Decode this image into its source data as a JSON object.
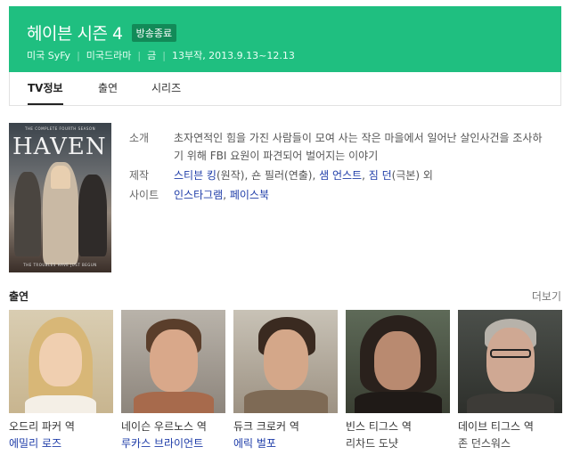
{
  "header": {
    "title": "헤이븐 시즌 4",
    "badge": "방송종료",
    "country": "미국 SyFy",
    "genre": "미국드라마",
    "day": "금",
    "episodes": "13부작, 2013.9.13~12.13",
    "bg_color": "#1fbf80"
  },
  "tabs": [
    {
      "label": "TV정보",
      "active": true
    },
    {
      "label": "출연",
      "active": false
    },
    {
      "label": "시리즈",
      "active": false
    }
  ],
  "poster": {
    "top_text": "THE COMPLETE FOURTH SEASON",
    "logo": "HAVEN",
    "bottom_text": "THE TROUBLES HAVE JUST BEGUN"
  },
  "info": {
    "intro_label": "소개",
    "intro_text": "초자연적인 힘을 가진 사람들이 모여 사는 작은 마을에서 일어난 살인사건을 조사하기 위해 FBI 요원이 파견되어 벌어지는 이야기",
    "prod_label": "제작",
    "prod": [
      {
        "name": "스티븐 킹",
        "role": "(원작)",
        "link": true
      },
      {
        "name": "숀 필러",
        "role": "(연출)",
        "link": false
      },
      {
        "name": "샘 언스트",
        "role": "",
        "link": true
      },
      {
        "name": "짐 던",
        "role": "(극본)",
        "link": false
      }
    ],
    "prod_suffix": "외",
    "site_label": "사이트",
    "sites": [
      "인스타그램",
      "페이스북"
    ]
  },
  "cast_section": {
    "title": "출연",
    "more": "더보기"
  },
  "cast": [
    {
      "role": "오드리 파커 역",
      "actor": "에밀리 로즈",
      "link": true
    },
    {
      "role": "네이슨 우르노스 역",
      "actor": "루카스 브라이언트",
      "link": true
    },
    {
      "role": "듀크 크로커 역",
      "actor": "에릭 벌포",
      "link": true
    },
    {
      "role": "빈스 티그스 역",
      "actor": "리차드 도냣",
      "link": false
    },
    {
      "role": "데이브 티그스 역",
      "actor": "존 던스워스",
      "link": false
    }
  ]
}
